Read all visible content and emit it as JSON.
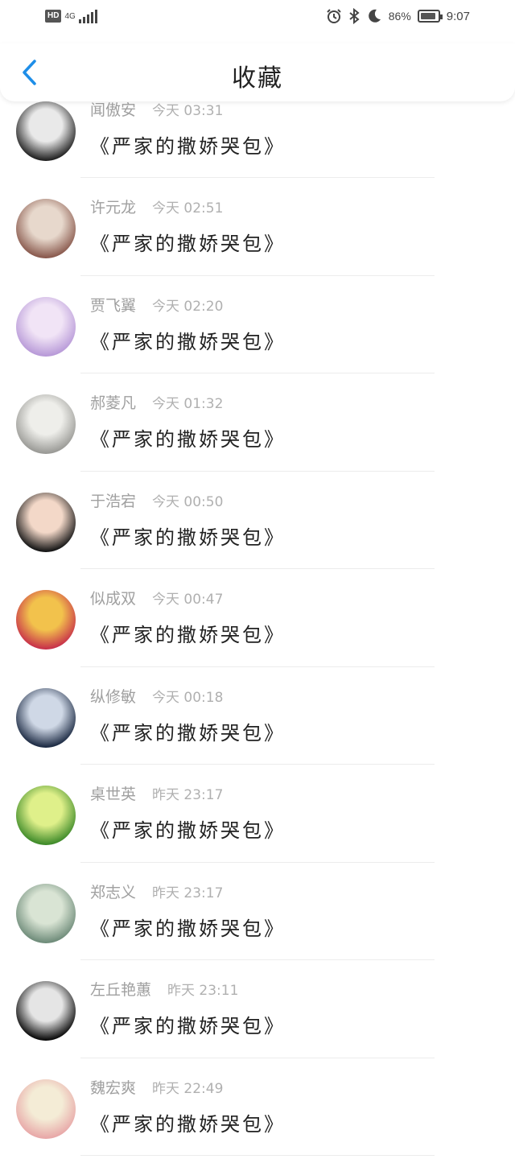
{
  "status_bar": {
    "hd": "HD",
    "network": "4G",
    "battery_percent": "86%",
    "battery_level": 0.86,
    "time": "9:07"
  },
  "header": {
    "title": "收藏"
  },
  "items": [
    {
      "name": "闻傲安",
      "time": "今天 03:31",
      "book": "《严家的撒娇哭包》",
      "avatar_colors": [
        "#222222",
        "#e9e9e9"
      ]
    },
    {
      "name": "许元龙",
      "time": "今天 02:51",
      "book": "《严家的撒娇哭包》",
      "avatar_colors": [
        "#8a5a4e",
        "#e7d8cc"
      ]
    },
    {
      "name": "贾飞翼",
      "time": "今天 02:20",
      "book": "《严家的撒娇哭包》",
      "avatar_colors": [
        "#b89ad8",
        "#f1e4f6"
      ]
    },
    {
      "name": "郝菱凡",
      "time": "今天 01:32",
      "book": "《严家的撒娇哭包》",
      "avatar_colors": [
        "#9a9a96",
        "#eeeeea"
      ]
    },
    {
      "name": "于浩宕",
      "time": "今天 00:50",
      "book": "《严家的撒娇哭包》",
      "avatar_colors": [
        "#161616",
        "#f3d8c8"
      ]
    },
    {
      "name": "似成双",
      "time": "今天 00:47",
      "book": "《严家的撒娇哭包》",
      "avatar_colors": [
        "#c8324a",
        "#f2c24c"
      ]
    },
    {
      "name": "纵修敏",
      "time": "今天 00:18",
      "book": "《严家的撒娇哭包》",
      "avatar_colors": [
        "#1d2b44",
        "#cfd8e6"
      ]
    },
    {
      "name": "桌世英",
      "time": "昨天 23:17",
      "book": "《严家的撒娇哭包》",
      "avatar_colors": [
        "#3f8b2a",
        "#dff08a"
      ]
    },
    {
      "name": "郑志义",
      "time": "昨天 23:17",
      "book": "《严家的撒娇哭包》",
      "avatar_colors": [
        "#6f8c7a",
        "#d9e4d4"
      ]
    },
    {
      "name": "左丘艳蕙",
      "time": "昨天 23:11",
      "book": "《严家的撒娇哭包》",
      "avatar_colors": [
        "#0b0b0b",
        "#e5e5e5"
      ]
    },
    {
      "name": "魏宏爽",
      "time": "昨天 22:49",
      "book": "《严家的撒娇哭包》",
      "avatar_colors": [
        "#e8a8a8",
        "#f4ecd6"
      ]
    }
  ],
  "colors": {
    "accent": "#1e8ee8",
    "meta_text": "#a0a0a0",
    "divider": "#ececec"
  }
}
